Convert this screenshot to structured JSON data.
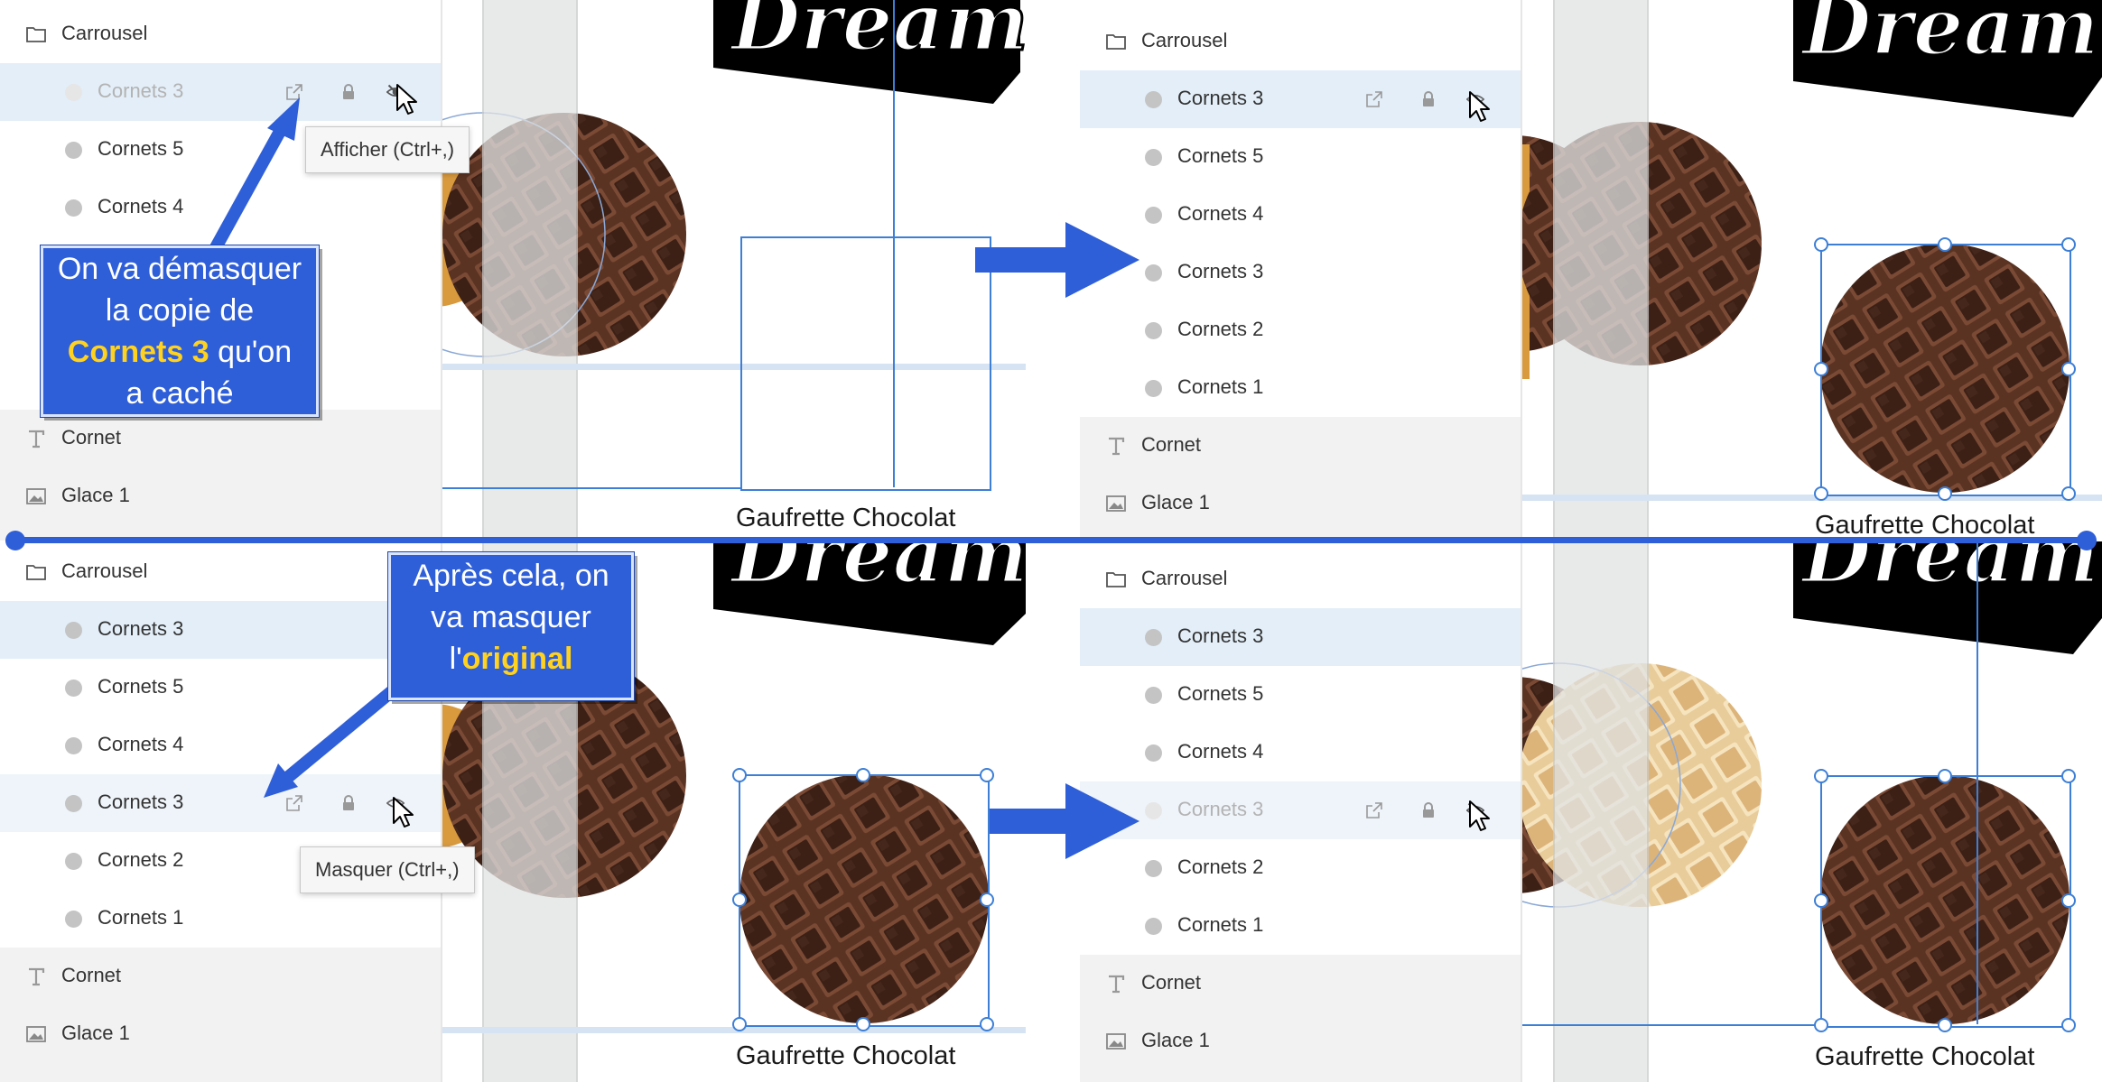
{
  "layers_panel": {
    "group_label": "Carrousel",
    "text_layer_label": "Cornet",
    "image_layer_label": "Glace 1"
  },
  "panel1": {
    "items": [
      {
        "label": "Cornets 3",
        "state": "hidden"
      },
      {
        "label": "Cornets 5"
      },
      {
        "label": "Cornets 4"
      }
    ]
  },
  "panel2": {
    "items": [
      {
        "label": "Cornets 3"
      },
      {
        "label": "Cornets 5"
      },
      {
        "label": "Cornets 4"
      },
      {
        "label": "Cornets 3"
      },
      {
        "label": "Cornets 2"
      },
      {
        "label": "Cornets 1"
      }
    ]
  },
  "panel3": {
    "items": [
      {
        "label": "Cornets 3"
      },
      {
        "label": "Cornets 5"
      },
      {
        "label": "Cornets 4"
      },
      {
        "label": "Cornets 3"
      },
      {
        "label": "Cornets 2"
      },
      {
        "label": "Cornets 1"
      }
    ]
  },
  "panel4": {
    "items": [
      {
        "label": "Cornets 3"
      },
      {
        "label": "Cornets 5"
      },
      {
        "label": "Cornets 4"
      },
      {
        "label": "Cornets 3",
        "state": "hidden"
      },
      {
        "label": "Cornets 2"
      },
      {
        "label": "Cornets 1"
      }
    ]
  },
  "canvas": {
    "caption": "Gaufrette Chocolat",
    "logo_text": "Dream"
  },
  "tooltips": {
    "show": "Afficher (Ctrl+,)",
    "hide": "Masquer (Ctrl+,)"
  },
  "callouts": {
    "first": {
      "line1": "On va démasquer",
      "line2": "la copie de",
      "highlight": "Cornets 3",
      "line3_rest": " qu'on",
      "line4": "a caché"
    },
    "second": {
      "line1": "Après cela, on",
      "line2": "va masquer",
      "line3_prefix": "l'",
      "highlight": "original"
    }
  },
  "colors": {
    "accent_blue": "#2f5fd8",
    "selection_blue": "#3d7fd6",
    "selected_row": "#e3eef8",
    "highlight_yellow": "#ffd21f"
  },
  "icons": [
    "folder-icon",
    "text-icon",
    "image-icon",
    "external-link-icon",
    "lock-icon",
    "eye-icon",
    "eye-off-icon",
    "mouse-pointer-icon"
  ]
}
